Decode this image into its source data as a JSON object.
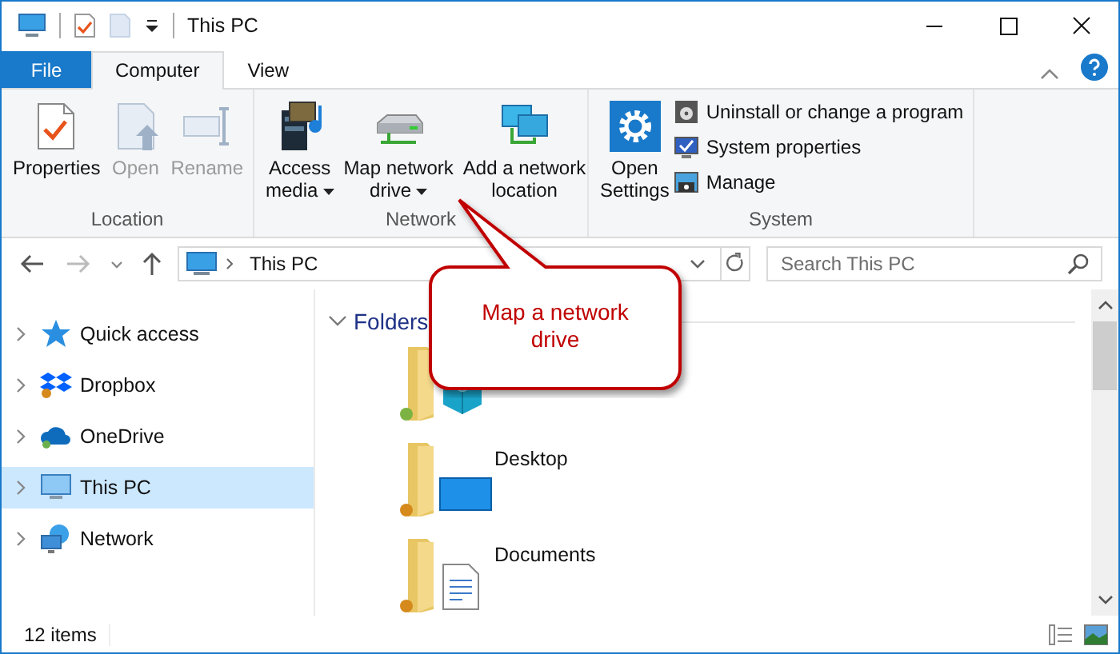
{
  "window": {
    "title": "This PC"
  },
  "ribbon_tabs": [
    {
      "label": "File",
      "kind": "file",
      "selected": false
    },
    {
      "label": "Computer",
      "kind": "tab",
      "selected": true
    },
    {
      "label": "View",
      "kind": "tab",
      "selected": false
    }
  ],
  "ribbon_groups": [
    {
      "label": "Location",
      "items": [
        {
          "kind": "large",
          "lines": [
            "Properties"
          ],
          "disabled": false,
          "dropdown": false
        },
        {
          "kind": "large",
          "lines": [
            "Open"
          ],
          "disabled": true,
          "dropdown": false
        },
        {
          "kind": "large",
          "lines": [
            "Rename"
          ],
          "disabled": true,
          "dropdown": false
        }
      ]
    },
    {
      "label": "Network",
      "items": [
        {
          "kind": "large",
          "lines": [
            "Access",
            "media"
          ],
          "disabled": false,
          "dropdown": true
        },
        {
          "kind": "large",
          "lines": [
            "Map network",
            "drive"
          ],
          "disabled": false,
          "dropdown": true
        },
        {
          "kind": "large",
          "lines": [
            "Add a network",
            "location"
          ],
          "disabled": false,
          "dropdown": false
        }
      ]
    },
    {
      "label": "System",
      "items": [
        {
          "kind": "large",
          "lines": [
            "Open",
            "Settings"
          ],
          "disabled": false,
          "dropdown": false
        },
        {
          "kind": "small",
          "lines": [
            "Uninstall or change a program"
          ],
          "disabled": false,
          "dropdown": false
        },
        {
          "kind": "small",
          "lines": [
            "System properties"
          ],
          "disabled": false,
          "dropdown": false
        },
        {
          "kind": "small",
          "lines": [
            "Manage"
          ],
          "disabled": false,
          "dropdown": false
        }
      ]
    }
  ],
  "address": {
    "path": "This PC"
  },
  "search": {
    "placeholder": "Search This PC"
  },
  "nav_items": [
    {
      "label": "Quick access",
      "selected": false
    },
    {
      "label": "Dropbox",
      "selected": false
    },
    {
      "label": "OneDrive",
      "selected": false
    },
    {
      "label": "This PC",
      "selected": true
    },
    {
      "label": "Network",
      "selected": false
    }
  ],
  "section": {
    "title": "Folders",
    "expanded": true
  },
  "folders": [
    {
      "kind": "objects"
    },
    {
      "kind": "desktop",
      "label": "Desktop"
    },
    {
      "kind": "documents",
      "label": "Documents"
    }
  ],
  "callout": {
    "lines": [
      "Map a network",
      "drive"
    ]
  },
  "status_bar": {
    "count": "12 items"
  }
}
